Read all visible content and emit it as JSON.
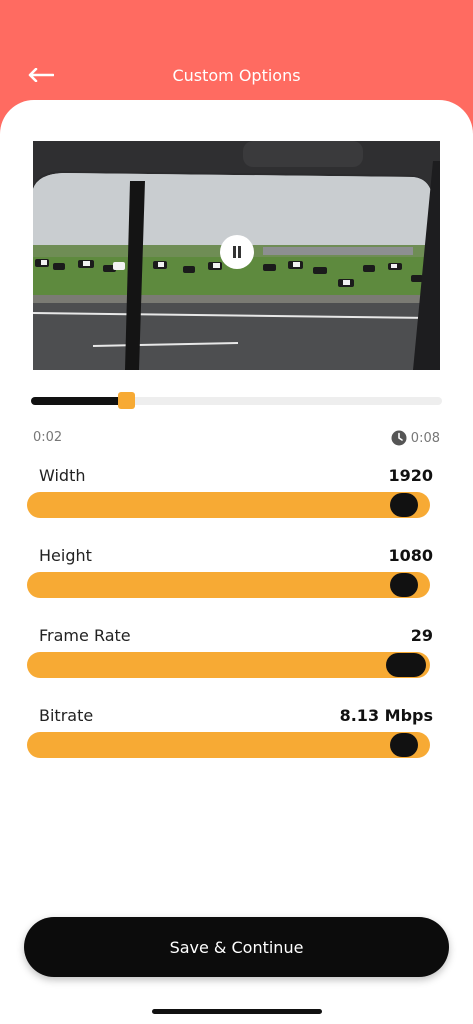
{
  "header": {
    "title": "Custom Options",
    "back_icon": "arrow-left-icon"
  },
  "video": {
    "state_icon": "pause-icon"
  },
  "playback": {
    "progress": 0.23,
    "current_time": "0:02",
    "total_time": "0:08",
    "clock_icon": "clock-icon"
  },
  "options": [
    {
      "label": "Width",
      "value": "1920",
      "level": 0.97
    },
    {
      "label": "Height",
      "value": "1080",
      "level": 0.97
    },
    {
      "label": "Frame Rate",
      "value": "29",
      "level": 0.99
    },
    {
      "label": "Bitrate",
      "value": "8.13 Mbps",
      "level": 0.97
    }
  ],
  "footer": {
    "save_label": "Save & Continue"
  },
  "colors": {
    "header": "#ff6b61",
    "accent": "#f7aa34",
    "dark": "#0c0c0c"
  }
}
